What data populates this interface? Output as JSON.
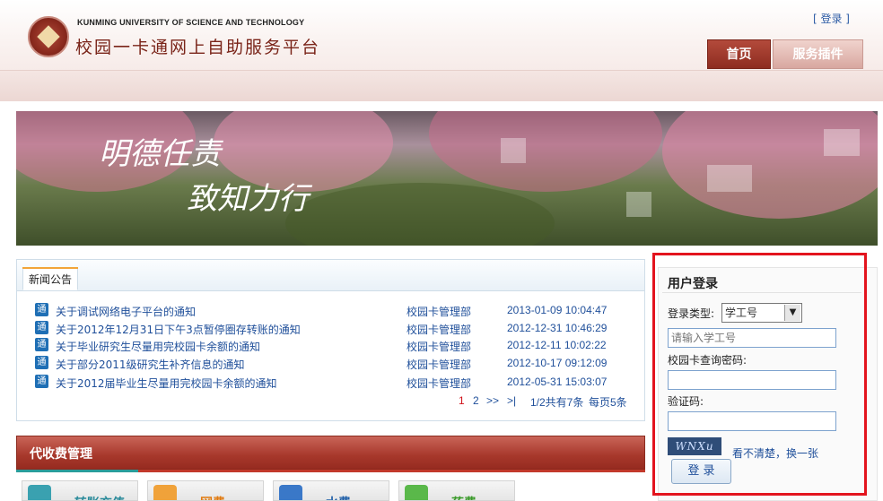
{
  "header": {
    "university_en": "KUNMING UNIVERSITY OF SCIENCE AND TECHNOLOGY",
    "platform_title": "校园一卡通网上自助服务平台",
    "top_login_link": "[ 登录 ]",
    "nav": [
      {
        "label": "首页",
        "active": true
      },
      {
        "label": "服务插件",
        "active": false
      }
    ]
  },
  "banner": {
    "calligraphy_line1": "明德任责",
    "calligraphy_line2": "致知力行"
  },
  "news": {
    "tab": "新闻公告",
    "icon_glyph": "通",
    "items": [
      {
        "title": "关于调试网络电子平台的通知",
        "dept": "校园卡管理部",
        "date": "2013-01-09 10:04:47"
      },
      {
        "title": "关于2012年12月31日下午3点暂停圈存转账的通知",
        "dept": "校园卡管理部",
        "date": "2012-12-31 10:46:29"
      },
      {
        "title": "关于毕业研究生尽量用完校园卡余额的通知",
        "dept": "校园卡管理部",
        "date": "2012-12-11 10:02:22"
      },
      {
        "title": "关于部分2011级研究生补齐信息的通知",
        "dept": "校园卡管理部",
        "date": "2012-10-17 09:12:09"
      },
      {
        "title": "关于2012届毕业生尽量用完校园卡余额的通知",
        "dept": "校园卡管理部",
        "date": "2012-05-31 15:03:07"
      }
    ],
    "pager": {
      "current": "1",
      "next_page": "2",
      "next": ">>",
      "last": ">|",
      "summary": "1/2共有7条",
      "per_page": "每页5条"
    }
  },
  "payment": {
    "title": "代收费管理",
    "items": [
      {
        "label": "转账充值",
        "color": "#2a8a9a",
        "icon_color": "#3aa1b0"
      },
      {
        "label": "网费",
        "color": "#e07a10",
        "icon_color": "#f0a23a"
      },
      {
        "label": "水费",
        "color": "#1f5fa8",
        "icon_color": "#3a78c8"
      },
      {
        "label": "药费",
        "color": "#3a9a2a",
        "icon_color": "#5ab84a"
      }
    ]
  },
  "login": {
    "title": "用户登录",
    "type_label": "登录类型:",
    "type_value": "学工号",
    "id_placeholder": "请输入学工号",
    "password_label": "校园卡查询密码:",
    "captcha_label": "验证码:",
    "captcha_text": "WNXu",
    "refresh_link": "看不清楚，换一张",
    "submit_label": "登 录"
  },
  "colors": {
    "brand_red": "#8e2c20",
    "link_blue": "#1f4f9a",
    "highlight_border": "#e3141e"
  }
}
